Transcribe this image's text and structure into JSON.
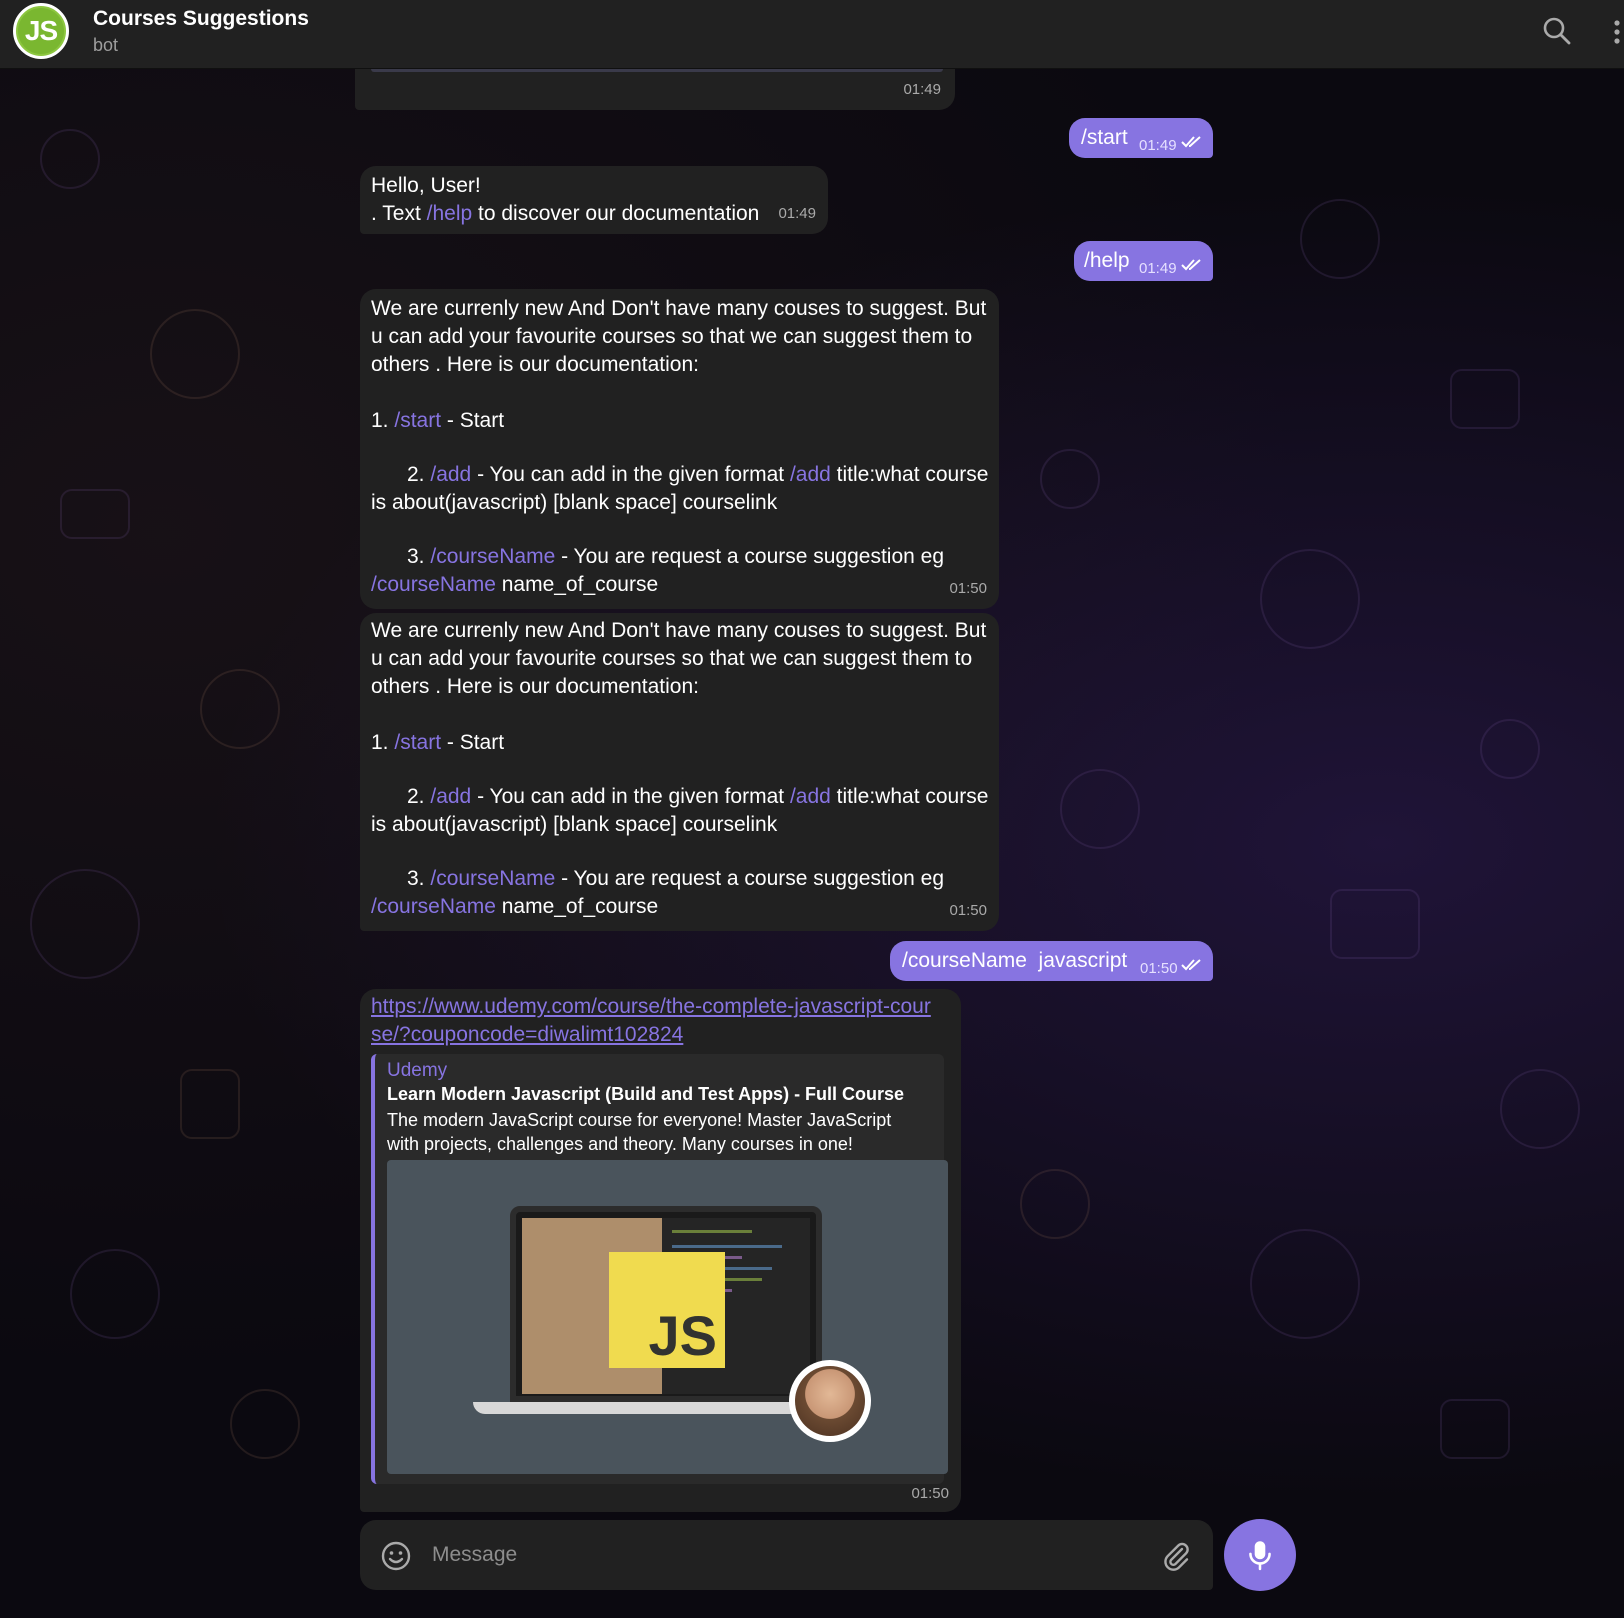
{
  "header": {
    "title": "Courses Suggestions",
    "subtitle": "bot",
    "avatar_text": "JS",
    "search_icon": "search-icon",
    "more_icon": "more-vertical-icon"
  },
  "messages": {
    "m0": {
      "time": "01:49"
    },
    "m1": {
      "text": "/start",
      "time": "01:49"
    },
    "m2": {
      "line1": "Hello, User!",
      "pre": ". Text ",
      "cmd": "/help",
      "post": " to discover our documentation",
      "time": "01:49"
    },
    "m3": {
      "text": "/help",
      "time": "01:49"
    },
    "m4": {
      "intro": "We are currenly new And Don't have many couses to suggest. But u can add your favourite courses so that we can suggest them to others . Here is our documentation:",
      "i1_pre": "1. ",
      "i1_cmd": "/start",
      "i1_post": " - Start",
      "i2_pre": "2. ",
      "i2_cmd": "/add",
      "i2_mid": " - You can add in the given format ",
      "i2_cmd2": "/add",
      "i2_post": " title:what course is about(javascript) [blank space] courselink",
      "i3_pre": "3. ",
      "i3_cmd": "/courseName",
      "i3_mid": " - You are request a course suggestion eg ",
      "i3_cmd2": "/courseName",
      "i3_post": " name_of_course",
      "time": "01:50"
    },
    "m5": {
      "intro": "We are currenly new And Don't have many couses to suggest. But u can add your favourite courses so that we can suggest them to others . Here is our documentation:",
      "i1_pre": "1. ",
      "i1_cmd": "/start",
      "i1_post": " - Start",
      "i2_pre": "2. ",
      "i2_cmd": "/add",
      "i2_mid": " - You can add in the given format ",
      "i2_cmd2": "/add",
      "i2_post": " title:what course is about(javascript) [blank space] courselink",
      "i3_pre": "3. ",
      "i3_cmd": "/courseName",
      "i3_mid": " - You are request a course suggestion eg ",
      "i3_cmd2": "/courseName",
      "i3_post": " name_of_course",
      "time": "01:50"
    },
    "m6": {
      "text": "/courseName  javascript",
      "time": "01:50"
    },
    "m7": {
      "link": "https://www.udemy.com/course/the-complete-javascript-course/?couponcode=diwalimt102824",
      "preview_site": "Udemy",
      "preview_title": "Learn Modern Javascript (Build and Test Apps) - Full Course",
      "preview_description": "The modern JavaScript course for everyone! Master JavaScript with projects, challenges and theory. Many courses in one!",
      "preview_badge": "JS",
      "time": "01:50"
    }
  },
  "composer": {
    "placeholder": "Message",
    "emoji_icon": "smile-icon",
    "attach_icon": "paperclip-icon",
    "mic_icon": "microphone-icon"
  },
  "colors": {
    "accent": "#8774e1",
    "incoming_bubble": "#212121",
    "header_bg": "#212121",
    "js_yellow": "#f0db4f"
  }
}
